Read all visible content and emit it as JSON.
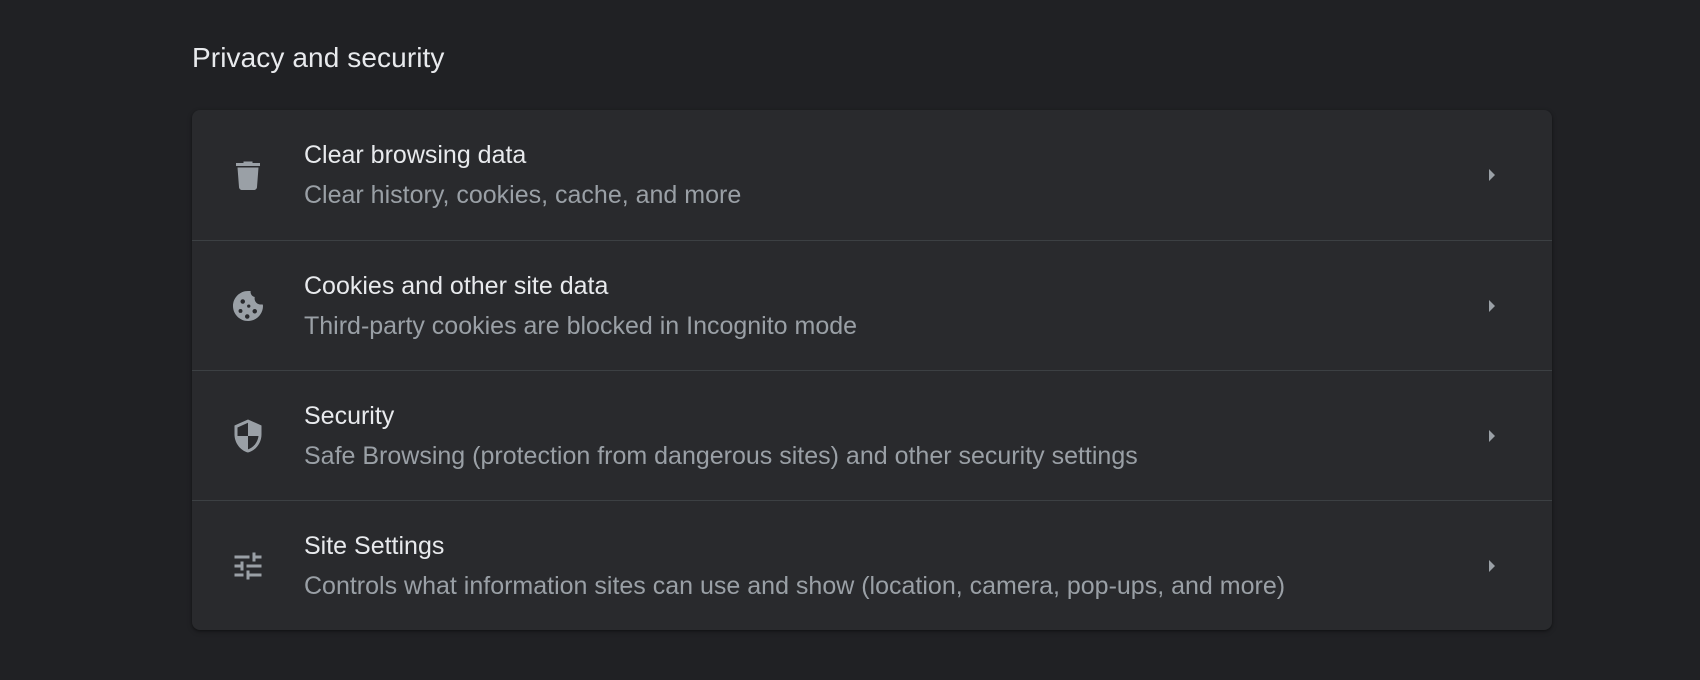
{
  "section": {
    "title": "Privacy and security"
  },
  "items": [
    {
      "title": "Clear browsing data",
      "subtitle": "Clear history, cookies, cache, and more",
      "icon": "trash-icon"
    },
    {
      "title": "Cookies and other site data",
      "subtitle": "Third-party cookies are blocked in Incognito mode",
      "icon": "cookie-icon"
    },
    {
      "title": "Security",
      "subtitle": "Safe Browsing (protection from dangerous sites) and other security settings",
      "icon": "shield-icon"
    },
    {
      "title": "Site Settings",
      "subtitle": "Controls what information sites can use and show (location, camera, pop-ups, and more)",
      "icon": "tune-icon"
    }
  ],
  "colors": {
    "background": "#202124",
    "card": "#292a2d",
    "divider": "#3c4043",
    "primary_text": "#e8eaed",
    "secondary_text": "#9aa0a6"
  }
}
